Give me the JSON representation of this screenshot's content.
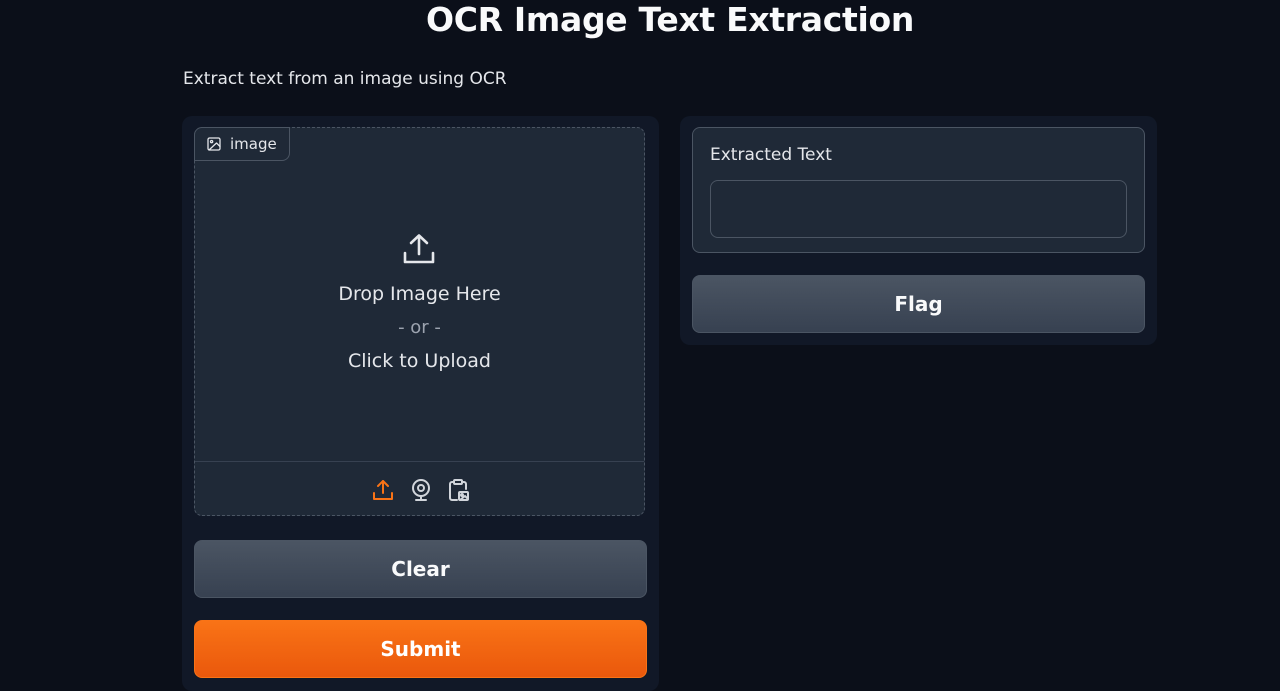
{
  "app": {
    "title": "OCR Image Text Extraction",
    "description": "Extract text from an image using OCR"
  },
  "input": {
    "label": "image",
    "label_icon": "image-icon",
    "drop_text": "Drop Image Here",
    "or_text": "- or -",
    "click_text": "Click to Upload",
    "sources": [
      {
        "name": "upload",
        "icon": "upload-icon",
        "active": true
      },
      {
        "name": "webcam",
        "icon": "webcam-icon",
        "active": false
      },
      {
        "name": "clipboard",
        "icon": "clipboard-icon",
        "active": false
      }
    ]
  },
  "output": {
    "label": "Extracted Text",
    "value": ""
  },
  "buttons": {
    "clear": "Clear",
    "submit": "Submit",
    "flag": "Flag"
  },
  "colors": {
    "background": "#0b0f19",
    "panel": "#111827",
    "block": "#1f2937",
    "accent": "#f97316",
    "secondary_button": "#4b5563"
  }
}
